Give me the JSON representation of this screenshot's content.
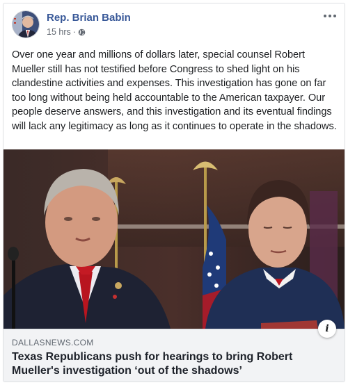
{
  "post": {
    "author": "Rep. Brian Babin",
    "timestamp": "15 hrs",
    "separator": "·",
    "privacy_icon": "globe-icon",
    "text": "Over one year and millions of dollars later, special counsel Robert Mueller still has not testified before Congress to shed light on his clandestine activities and expenses. This investigation has gone on far too long without being held accountable to the American taxpayer. Our people deserve answers, and this investigation and its eventual findings will lack any legitimacy as long as it continues to operate in the shadows."
  },
  "link_preview": {
    "domain": "DALLASNEWS.COM",
    "title": "Texas Republicans push for hearings to bring Robert Mueller's investigation ‘out of the shadows’",
    "info_label": "i"
  },
  "colors": {
    "author": "#385898",
    "text": "#1c1e21",
    "meta": "#616770",
    "link_bg": "#f2f3f5"
  }
}
